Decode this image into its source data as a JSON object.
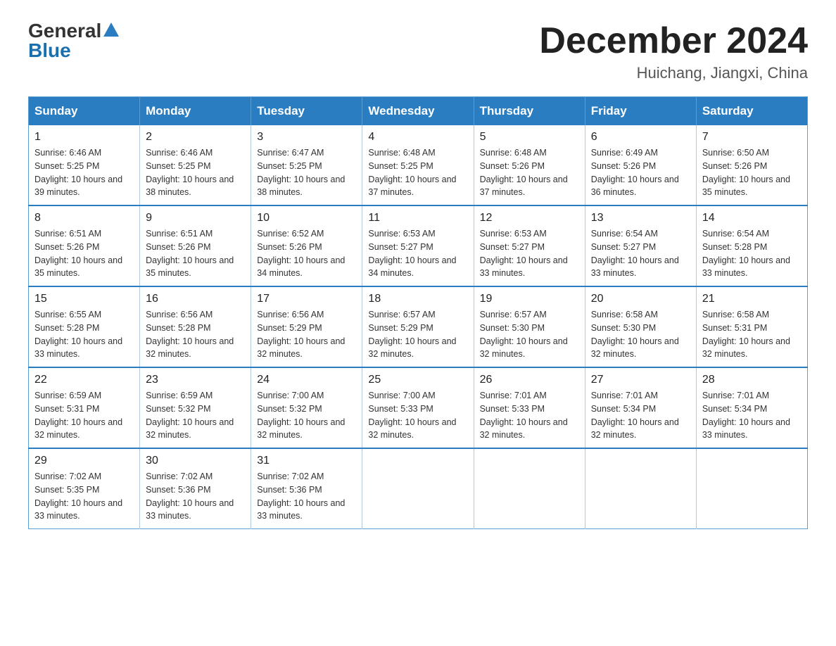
{
  "logo": {
    "general": "General",
    "blue": "Blue"
  },
  "title": {
    "month_year": "December 2024",
    "location": "Huichang, Jiangxi, China"
  },
  "weekdays": [
    "Sunday",
    "Monday",
    "Tuesday",
    "Wednesday",
    "Thursday",
    "Friday",
    "Saturday"
  ],
  "weeks": [
    [
      {
        "day": "1",
        "sunrise": "6:46 AM",
        "sunset": "5:25 PM",
        "daylight": "10 hours and 39 minutes."
      },
      {
        "day": "2",
        "sunrise": "6:46 AM",
        "sunset": "5:25 PM",
        "daylight": "10 hours and 38 minutes."
      },
      {
        "day": "3",
        "sunrise": "6:47 AM",
        "sunset": "5:25 PM",
        "daylight": "10 hours and 38 minutes."
      },
      {
        "day": "4",
        "sunrise": "6:48 AM",
        "sunset": "5:25 PM",
        "daylight": "10 hours and 37 minutes."
      },
      {
        "day": "5",
        "sunrise": "6:48 AM",
        "sunset": "5:26 PM",
        "daylight": "10 hours and 37 minutes."
      },
      {
        "day": "6",
        "sunrise": "6:49 AM",
        "sunset": "5:26 PM",
        "daylight": "10 hours and 36 minutes."
      },
      {
        "day": "7",
        "sunrise": "6:50 AM",
        "sunset": "5:26 PM",
        "daylight": "10 hours and 35 minutes."
      }
    ],
    [
      {
        "day": "8",
        "sunrise": "6:51 AM",
        "sunset": "5:26 PM",
        "daylight": "10 hours and 35 minutes."
      },
      {
        "day": "9",
        "sunrise": "6:51 AM",
        "sunset": "5:26 PM",
        "daylight": "10 hours and 35 minutes."
      },
      {
        "day": "10",
        "sunrise": "6:52 AM",
        "sunset": "5:26 PM",
        "daylight": "10 hours and 34 minutes."
      },
      {
        "day": "11",
        "sunrise": "6:53 AM",
        "sunset": "5:27 PM",
        "daylight": "10 hours and 34 minutes."
      },
      {
        "day": "12",
        "sunrise": "6:53 AM",
        "sunset": "5:27 PM",
        "daylight": "10 hours and 33 minutes."
      },
      {
        "day": "13",
        "sunrise": "6:54 AM",
        "sunset": "5:27 PM",
        "daylight": "10 hours and 33 minutes."
      },
      {
        "day": "14",
        "sunrise": "6:54 AM",
        "sunset": "5:28 PM",
        "daylight": "10 hours and 33 minutes."
      }
    ],
    [
      {
        "day": "15",
        "sunrise": "6:55 AM",
        "sunset": "5:28 PM",
        "daylight": "10 hours and 33 minutes."
      },
      {
        "day": "16",
        "sunrise": "6:56 AM",
        "sunset": "5:28 PM",
        "daylight": "10 hours and 32 minutes."
      },
      {
        "day": "17",
        "sunrise": "6:56 AM",
        "sunset": "5:29 PM",
        "daylight": "10 hours and 32 minutes."
      },
      {
        "day": "18",
        "sunrise": "6:57 AM",
        "sunset": "5:29 PM",
        "daylight": "10 hours and 32 minutes."
      },
      {
        "day": "19",
        "sunrise": "6:57 AM",
        "sunset": "5:30 PM",
        "daylight": "10 hours and 32 minutes."
      },
      {
        "day": "20",
        "sunrise": "6:58 AM",
        "sunset": "5:30 PM",
        "daylight": "10 hours and 32 minutes."
      },
      {
        "day": "21",
        "sunrise": "6:58 AM",
        "sunset": "5:31 PM",
        "daylight": "10 hours and 32 minutes."
      }
    ],
    [
      {
        "day": "22",
        "sunrise": "6:59 AM",
        "sunset": "5:31 PM",
        "daylight": "10 hours and 32 minutes."
      },
      {
        "day": "23",
        "sunrise": "6:59 AM",
        "sunset": "5:32 PM",
        "daylight": "10 hours and 32 minutes."
      },
      {
        "day": "24",
        "sunrise": "7:00 AM",
        "sunset": "5:32 PM",
        "daylight": "10 hours and 32 minutes."
      },
      {
        "day": "25",
        "sunrise": "7:00 AM",
        "sunset": "5:33 PM",
        "daylight": "10 hours and 32 minutes."
      },
      {
        "day": "26",
        "sunrise": "7:01 AM",
        "sunset": "5:33 PM",
        "daylight": "10 hours and 32 minutes."
      },
      {
        "day": "27",
        "sunrise": "7:01 AM",
        "sunset": "5:34 PM",
        "daylight": "10 hours and 32 minutes."
      },
      {
        "day": "28",
        "sunrise": "7:01 AM",
        "sunset": "5:34 PM",
        "daylight": "10 hours and 33 minutes."
      }
    ],
    [
      {
        "day": "29",
        "sunrise": "7:02 AM",
        "sunset": "5:35 PM",
        "daylight": "10 hours and 33 minutes."
      },
      {
        "day": "30",
        "sunrise": "7:02 AM",
        "sunset": "5:36 PM",
        "daylight": "10 hours and 33 minutes."
      },
      {
        "day": "31",
        "sunrise": "7:02 AM",
        "sunset": "5:36 PM",
        "daylight": "10 hours and 33 minutes."
      },
      null,
      null,
      null,
      null
    ]
  ],
  "labels": {
    "sunrise": "Sunrise:",
    "sunset": "Sunset:",
    "daylight": "Daylight:"
  }
}
